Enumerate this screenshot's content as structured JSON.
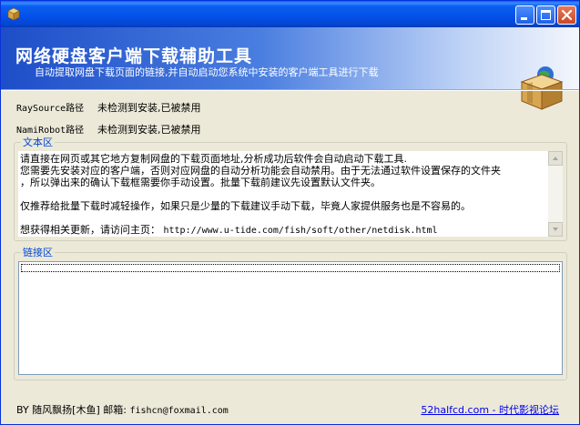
{
  "banner": {
    "title": "网络硬盘客户端下载辅助工具",
    "subtitle": "自动提取网盘下载页面的链接,并自动启动您系统中安装的客户端工具进行下载"
  },
  "paths": [
    {
      "label": "RaySource路径",
      "value": "未检测到安装,已被禁用"
    },
    {
      "label": "NamiRobot路径",
      "value": "未检测到安装,已被禁用"
    }
  ],
  "text_area": {
    "legend": "文本区",
    "lines": [
      "请直接在网页或其它地方复制网盘的下载页面地址,分析成功后软件会自动启动下载工具.",
      "您需要先安装对应的客户端，否则对应网盘的自动分析功能会自动禁用。由于无法通过软件设置保存的文件夹",
      "，所以弹出来的确认下载框需要你手动设置。批量下载前建议先设置默认文件夹。",
      "",
      "仅推荐给批量下载时减轻操作，如果只是少量的下载建议手动下载，毕竟人家提供服务也是不容易的。",
      "",
      "想获得相关更新，请访问主页： "
    ],
    "homepage_url": "http://www.u-tide.com/fish/soft/other/netdisk.html"
  },
  "link_area": {
    "legend": "链接区",
    "items": []
  },
  "footer": {
    "author_label": "BY 随风飘扬[木鱼] 邮箱:",
    "email": "fishcn@foxmail.com",
    "forum_link": "52halfcd.com - 时代影视论坛"
  },
  "icons": {
    "app": "box-icon",
    "banner": "gift-box-with-globe-icon"
  }
}
